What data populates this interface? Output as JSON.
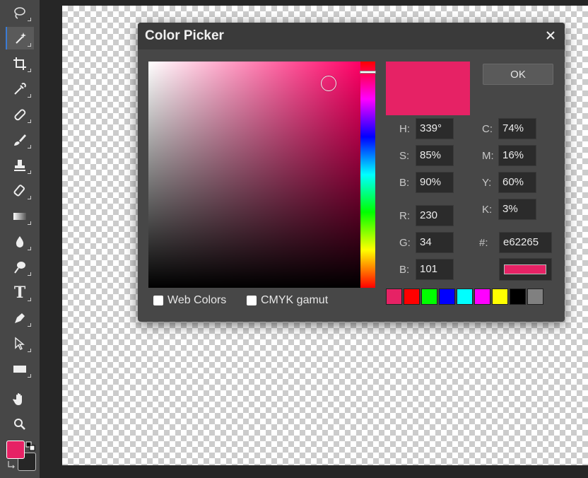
{
  "dialog": {
    "title": "Color Picker",
    "ok_label": "OK"
  },
  "color": {
    "h": "339°",
    "s": "85%",
    "b": "90%",
    "r": "230",
    "g": "34",
    "b_rgb": "101",
    "c": "74%",
    "m": "16%",
    "y": "60%",
    "k": "3%",
    "hex": "e62265",
    "hex_color": "#e62265"
  },
  "labels": {
    "h": "H:",
    "s": "S:",
    "b": "B:",
    "r": "R:",
    "g": "G:",
    "b_rgb": "B:",
    "c": "C:",
    "m": "M:",
    "y": "Y:",
    "k": "K:",
    "hex": "#:"
  },
  "options": {
    "web_colors": "Web Colors",
    "cmyk_gamut": "CMYK gamut"
  },
  "palette": [
    "#e62265",
    "#ff0000",
    "#00ff00",
    "#0000ff",
    "#00ffff",
    "#ff00ff",
    "#ffff00",
    "#000000",
    "#808080"
  ],
  "tools": [
    {
      "name": "lasso-tool",
      "icon": "lasso-icon"
    },
    {
      "name": "magic-wand-tool",
      "icon": "magic-wand-icon",
      "active": true
    },
    {
      "name": "crop-tool",
      "icon": "crop-icon"
    },
    {
      "name": "eyedropper-tool",
      "icon": "eyedropper-icon"
    },
    {
      "name": "healing-tool",
      "icon": "bandage-icon"
    },
    {
      "name": "brush-tool",
      "icon": "brush-icon"
    },
    {
      "name": "clone-stamp-tool",
      "icon": "stamp-icon"
    },
    {
      "name": "eraser-tool",
      "icon": "eraser-icon"
    },
    {
      "name": "gradient-tool",
      "icon": "gradient-icon"
    },
    {
      "name": "blur-tool",
      "icon": "drop-icon"
    },
    {
      "name": "dodge-tool",
      "icon": "dodge-icon"
    },
    {
      "name": "type-tool",
      "icon": "type-icon",
      "glyph": "T"
    },
    {
      "name": "pen-tool",
      "icon": "pen-icon"
    },
    {
      "name": "path-select-tool",
      "icon": "path-select-icon"
    },
    {
      "name": "rectangle-tool",
      "icon": "rectangle-icon"
    },
    {
      "name": "hand-tool",
      "icon": "hand-icon"
    },
    {
      "name": "zoom-tool",
      "icon": "zoom-icon"
    }
  ],
  "foreground_color": "#e62265",
  "background_color": "#262626"
}
